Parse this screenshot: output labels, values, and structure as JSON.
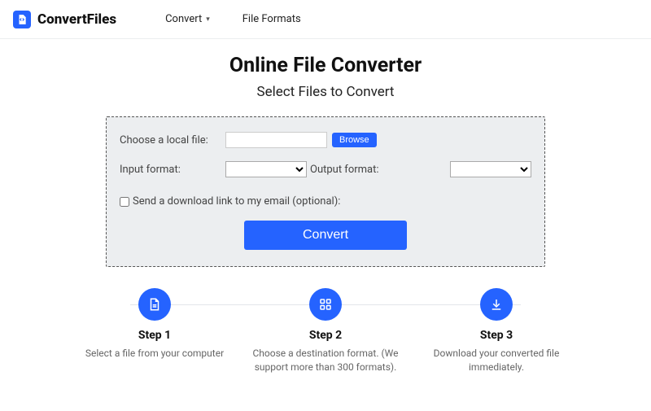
{
  "brand": {
    "name": "ConvertFiles"
  },
  "nav": {
    "convert": "Convert",
    "formats": "File Formats"
  },
  "page": {
    "title": "Online File Converter",
    "subtitle": "Select Files to Convert"
  },
  "form": {
    "choose_label": "Choose a local file:",
    "browse_label": "Browse",
    "input_format_label": "Input format:",
    "output_format_label": "Output format:",
    "email_checkbox_label": "Send a download link to my email (optional):",
    "convert_label": "Convert",
    "file_value": "",
    "input_format_value": "",
    "output_format_value": ""
  },
  "steps": [
    {
      "title": "Step 1",
      "desc": "Select a file from your computer"
    },
    {
      "title": "Step 2",
      "desc": "Choose a destination format. (We support more than 300 formats)."
    },
    {
      "title": "Step 3",
      "desc": "Download your converted file immediately."
    }
  ]
}
